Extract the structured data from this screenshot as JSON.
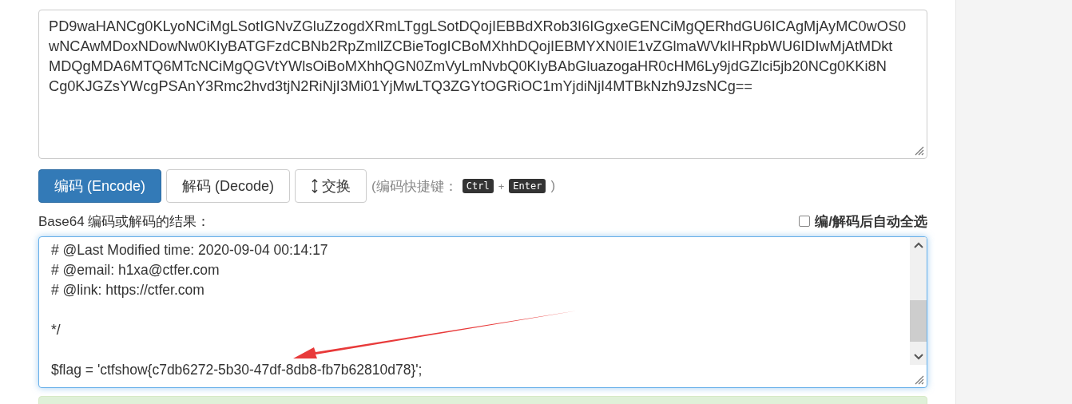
{
  "input": {
    "lines": [
      "PD9waHANCg0KLyoNCiMgLSotIGNvZGluZzogdXRmLTggLSotDQojIEBBdXRob3I6IGgxeGENCiMgQERhdGU6ICAgMjAyMC0wOS0",
      "wNCAwMDoxNDowNw0KIyBATGFzdCBNb2RpZmllZCBieTogICBoMXhhDQojIEBMYXN0IE1vZGlmaWVkIHRpbWU6IDIwMjAtMDkt",
      "MDQgMDA6MTQ6MTcNCiMgQGVtYWlsOiBoMXhhQGN0ZmVyLmNvbQ0KIyBAbGluazogaHR0cHM6Ly9jdGZlci5jb20NCg0KKi8N",
      "Cg0KJGZsYWcgPSAnY3Rmc2hvd3tjN2RiNjI3Mi01YjMwLTQ3ZGYtOGRiOC1mYjdiNjI4MTBkNzh9JzsNCg=="
    ]
  },
  "buttons": [
    {
      "label": "编码 (Encode)",
      "kind": "primary"
    },
    {
      "label": "解码 (Decode)",
      "kind": "default"
    },
    {
      "label": "交换",
      "kind": "swap"
    }
  ],
  "shortcut": {
    "prefix": "(编码快捷键：",
    "keys": [
      "Ctrl",
      "Enter"
    ],
    "joiner": "+",
    "suffix": ")"
  },
  "result": {
    "label": "Base64 编码或解码的结果：",
    "auto_select": {
      "label": "编/解码后自动全选",
      "checked": false
    },
    "blocks": [
      [
        "# @Last Modified time: 2020-09-04 00:14:17",
        "# @email: h1xa@ctfer.com",
        "# @link: https://ctfer.com"
      ],
      [
        "*/"
      ],
      [
        "$flag = 'ctfshow{c7db6272-5b30-47df-8db8-fb7b62810d78}';"
      ]
    ]
  }
}
